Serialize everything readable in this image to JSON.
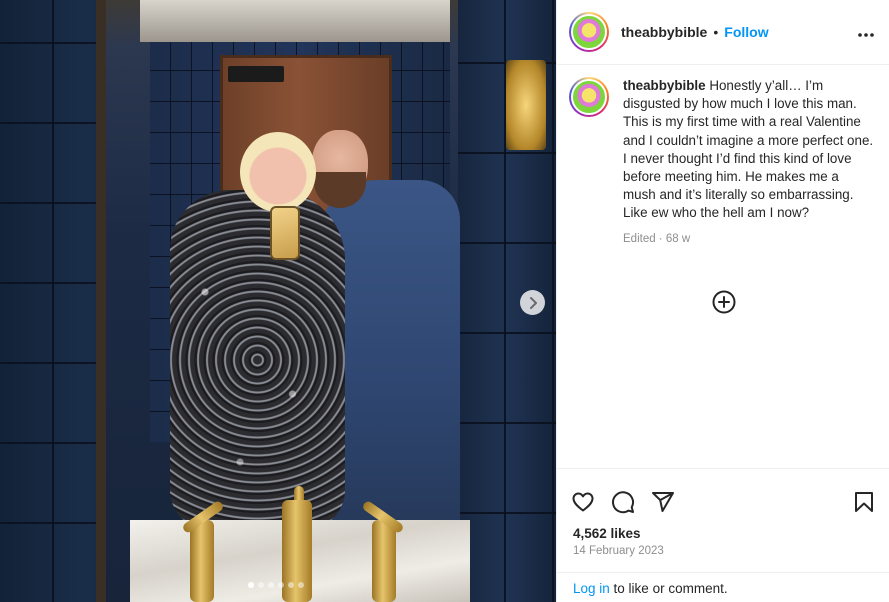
{
  "post": {
    "carousel": {
      "next_icon": "chevron-right-icon",
      "dot_count": 6,
      "active_dot": 0
    }
  },
  "header": {
    "username": "theabbybible",
    "separator": "•",
    "follow_label": "Follow",
    "more_icon": "more-horizontal-icon",
    "more_glyph": "•••"
  },
  "caption": {
    "username": "theabbybible",
    "text": " Honestly y’all… I’m disgusted by how much I love this man. This is my first time with a real Valentine and I couldn’t imagine a more perfect one. I never thought I’d find this kind of love before meeting him. He makes me a mush and it’s literally so embarrassing. Like ew who the hell am I now?",
    "edited_label": "Edited",
    "meta_sep": " · ",
    "time_ago": "68 w"
  },
  "actions": {
    "like_icon": "heart-icon",
    "comment_icon": "comment-icon",
    "share_icon": "share-icon",
    "save_icon": "bookmark-icon",
    "add_comment_icon": "add-circle-icon"
  },
  "stats": {
    "likes": "4,562 likes",
    "date": "14 February 2023"
  },
  "footer": {
    "login_link": "Log in",
    "login_rest": " to like or comment."
  },
  "colors": {
    "link_blue": "#0095f6",
    "text": "#262626",
    "muted": "#8e8e8e",
    "border": "#efefef"
  }
}
